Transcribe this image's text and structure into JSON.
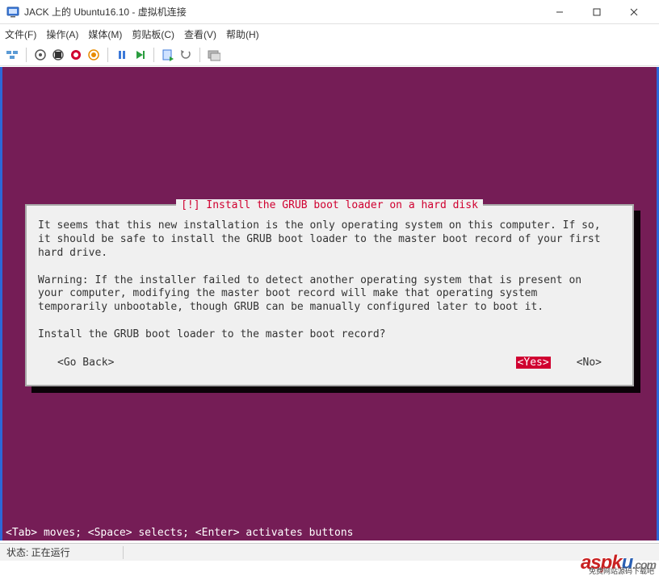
{
  "window": {
    "title": "JACK 上的 Ubuntu16.10 - 虚拟机连接"
  },
  "menu": {
    "file": "文件(F)",
    "action": "操作(A)",
    "media": "媒体(M)",
    "clipboard": "剪贴板(C)",
    "view": "查看(V)",
    "help": "帮助(H)"
  },
  "dialog": {
    "title": "[!] Install the GRUB boot loader on a hard disk",
    "body": "It seems that this new installation is the only operating system on this computer. If so,\nit should be safe to install the GRUB boot loader to the master boot record of your first\nhard drive.\n\nWarning: If the installer failed to detect another operating system that is present on\nyour computer, modifying the master boot record will make that operating system\ntemporarily unbootable, though GRUB can be manually configured later to boot it.\n\nInstall the GRUB boot loader to the master boot record?",
    "go_back": "<Go Back>",
    "yes": "<Yes>",
    "no": "<No>"
  },
  "hint": "<Tab> moves; <Space> selects; <Enter> activates buttons",
  "status": {
    "label": "状态: 正在运行"
  },
  "watermark": {
    "main_a": "aspk",
    "main_b": "u",
    "main_c": ".com",
    "sub": "免费网站源码下载吧"
  }
}
